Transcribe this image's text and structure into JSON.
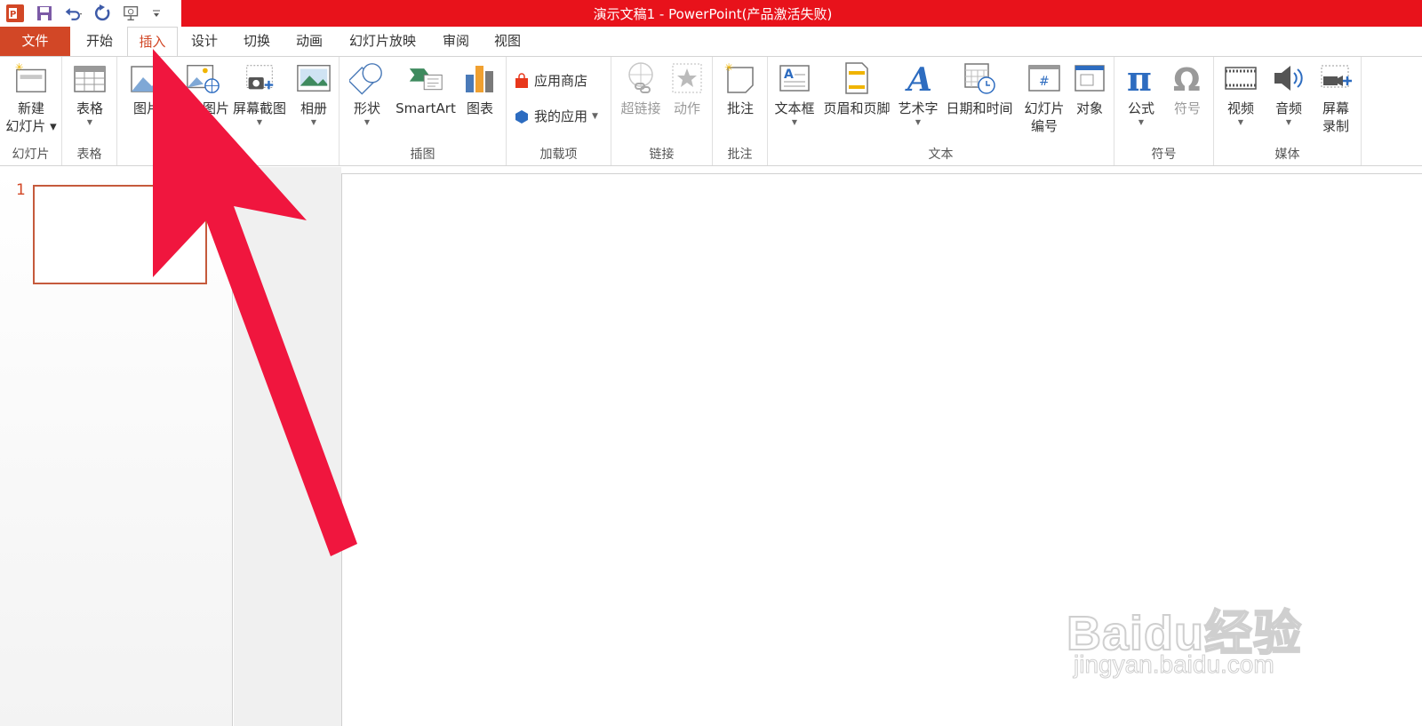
{
  "window": {
    "title": "演示文稿1 -  PowerPoint(产品激活失败)"
  },
  "qat": {
    "icons": [
      "powerpoint-logo-icon",
      "save-icon",
      "undo-icon",
      "redo-icon",
      "presentation-icon",
      "customize-icon"
    ]
  },
  "tabs": [
    {
      "label": "文件"
    },
    {
      "label": "开始"
    },
    {
      "label": "插入"
    },
    {
      "label": "设计"
    },
    {
      "label": "切换"
    },
    {
      "label": "动画"
    },
    {
      "label": "幻灯片放映"
    },
    {
      "label": "审阅"
    },
    {
      "label": "视图"
    }
  ],
  "ribbon": {
    "slides": {
      "new_slide": "新建",
      "new_slide2": "幻灯片",
      "group": "幻灯片"
    },
    "tables": {
      "table": "表格",
      "group": "表格"
    },
    "images": {
      "picture": "图片",
      "online_picture": "联机图片",
      "screenshot": "屏幕截图",
      "album": "相册"
    },
    "illustrations": {
      "shapes": "形状",
      "smartart": "SmartArt",
      "chart": "图表",
      "group": "插图"
    },
    "addins": {
      "store": "应用商店",
      "my_apps": "我的应用",
      "group": "加载项"
    },
    "links": {
      "hyperlink": "超链接",
      "action": "动作",
      "group": "链接"
    },
    "comments": {
      "comment": "批注",
      "group": "批注"
    },
    "text": {
      "textbox": "文本框",
      "header_footer": "页眉和页脚",
      "wordart": "艺术字",
      "datetime": "日期和时间",
      "slide_number": "幻灯片",
      "slide_number2": "编号",
      "object": "对象",
      "group": "文本"
    },
    "symbols": {
      "equation": "公式",
      "symbol": "符号",
      "group": "符号"
    },
    "media": {
      "video": "视频",
      "audio": "音频",
      "screen_recording": "屏幕",
      "screen_recording2": "录制",
      "group": "媒体"
    }
  },
  "thumbnails": {
    "slide_number": "1"
  },
  "watermark": {
    "logo": "Baidu经验",
    "url": "jingyan.baidu.com"
  },
  "colors": {
    "title_bar": "#e8121b",
    "file_tab": "#d24726",
    "annotation_arrow": "#f0163e"
  }
}
